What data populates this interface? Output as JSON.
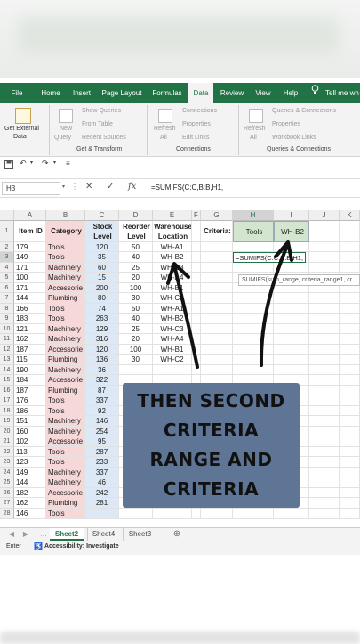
{
  "tabs": [
    "File",
    "Home",
    "Insert",
    "Page Layout",
    "Formulas",
    "Data",
    "Review",
    "View",
    "Help",
    "Tell me wh"
  ],
  "active_tab": "Data",
  "ribbon": {
    "get_external": "Get External",
    "get_external2": "Data",
    "new_query": "New",
    "new_query2": "Query",
    "show_queries": "Show Queries",
    "from_table": "From Table",
    "recent_sources": "Recent Sources",
    "refresh": "Refresh",
    "refresh_all": "All",
    "connections": "Connections",
    "properties": "Properties",
    "edit_links": "Edit Links",
    "refresh2": "Refresh",
    "refresh_all2": "All",
    "queries_connections": "Queries & Connections",
    "properties2": "Properties",
    "workbook_links": "Workbook Links",
    "group_get_transform": "Get & Transform",
    "group_connections": "Connections",
    "group_queries": "Queries & Connections"
  },
  "formula_bar": {
    "name_box": "H3",
    "formula": "=SUMIFS(C:C,B:B,H1,"
  },
  "columns": [
    "A",
    "B",
    "C",
    "D",
    "E",
    "F",
    "G",
    "H",
    "I",
    "J",
    "K"
  ],
  "headers": {
    "a": "Item ID",
    "b": "Category",
    "c": "Stock Level",
    "d": "Reorder Level",
    "e": "Warehouse Location",
    "g": "Criteria:",
    "h": "Tools",
    "i": "WH-B2"
  },
  "rows": [
    [
      "179",
      "Tools",
      "120",
      "50",
      "WH-A1"
    ],
    [
      "149",
      "Tools",
      "35",
      "40",
      "WH-B2"
    ],
    [
      "171",
      "Machinery",
      "60",
      "25",
      "WH-C3"
    ],
    [
      "100",
      "Machinery",
      "15",
      "20",
      "WH-A4"
    ],
    [
      "171",
      "Accessorie",
      "200",
      "100",
      "WH-B1"
    ],
    [
      "144",
      "Plumbing",
      "80",
      "30",
      "WH-C2"
    ],
    [
      "166",
      "Tools",
      "74",
      "50",
      "WH-A1"
    ],
    [
      "183",
      "Tools",
      "263",
      "40",
      "WH-B2"
    ],
    [
      "121",
      "Machinery",
      "129",
      "25",
      "WH-C3"
    ],
    [
      "162",
      "Machinery",
      "316",
      "20",
      "WH-A4"
    ],
    [
      "187",
      "Accessorie",
      "120",
      "100",
      "WH-B1"
    ],
    [
      "115",
      "Plumbing",
      "136",
      "30",
      "WH-C2"
    ],
    [
      "190",
      "Machinery",
      "36",
      "",
      ""
    ],
    [
      "184",
      "Accessorie",
      "322",
      "",
      ""
    ],
    [
      "187",
      "Plumbing",
      "87",
      "",
      ""
    ],
    [
      "176",
      "Tools",
      "337",
      "",
      ""
    ],
    [
      "186",
      "Tools",
      "92",
      "",
      ""
    ],
    [
      "151",
      "Machinery",
      "146",
      "",
      ""
    ],
    [
      "160",
      "Machinery",
      "254",
      "",
      ""
    ],
    [
      "102",
      "Accessorie",
      "95",
      "",
      ""
    ],
    [
      "113",
      "Tools",
      "287",
      "",
      ""
    ],
    [
      "123",
      "Tools",
      "233",
      "",
      ""
    ],
    [
      "149",
      "Machinery",
      "337",
      "",
      ""
    ],
    [
      "144",
      "Machinery",
      "46",
      "",
      ""
    ],
    [
      "182",
      "Accessorie",
      "242",
      "",
      ""
    ],
    [
      "162",
      "Plumbing",
      "281",
      "50",
      "WH-A4"
    ],
    [
      "146",
      "Tools",
      "",
      "",
      ""
    ]
  ],
  "row_numbers": [
    "1",
    "2",
    "3",
    "4",
    "5",
    "6",
    "7",
    "8",
    "9",
    "10",
    "11",
    "12",
    "13",
    "14",
    "15",
    "16",
    "17",
    "18",
    "19",
    "20",
    "21",
    "22",
    "23",
    "24",
    "25",
    "26",
    "27",
    "28"
  ],
  "editing_cell": "=SUMIFS(C:C,B:B,H1,",
  "tooltip": "SUMIFS(sum_range, criteria_range1, cr",
  "caption": [
    "THEN SECOND",
    "CRITERIA",
    "RANGE AND",
    "CRITERIA"
  ],
  "sheets": [
    "Sheet2",
    "Sheet4",
    "Sheet3"
  ],
  "active_sheet": "Sheet2",
  "status": {
    "mode": "Enter",
    "accessibility": "Accessibility: Investigate"
  }
}
